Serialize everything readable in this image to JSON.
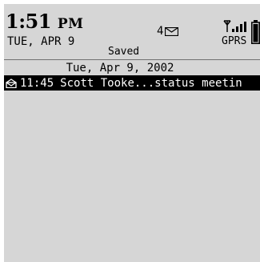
{
  "status_bar": {
    "time_main": "1:51",
    "time_ampm": "PM",
    "date_short": "TUE, APR 9",
    "saved_label": "Saved",
    "unread_count": "4",
    "network_label": "GPRS",
    "icons": {
      "envelope": "envelope-icon",
      "signal": "signal-antenna-icon",
      "battery": "battery-icon"
    }
  },
  "message_list": {
    "date_header": "Tue, Apr 9, 2002",
    "items": [
      {
        "icon": "opened-envelope-icon",
        "time": "11:45",
        "summary": "Scott Tooke...status meetin",
        "selected": true
      }
    ]
  },
  "colors": {
    "background": "#d6d6d6",
    "text": "#000000",
    "selection_bg": "#000000",
    "selection_text": "#ffffff"
  }
}
